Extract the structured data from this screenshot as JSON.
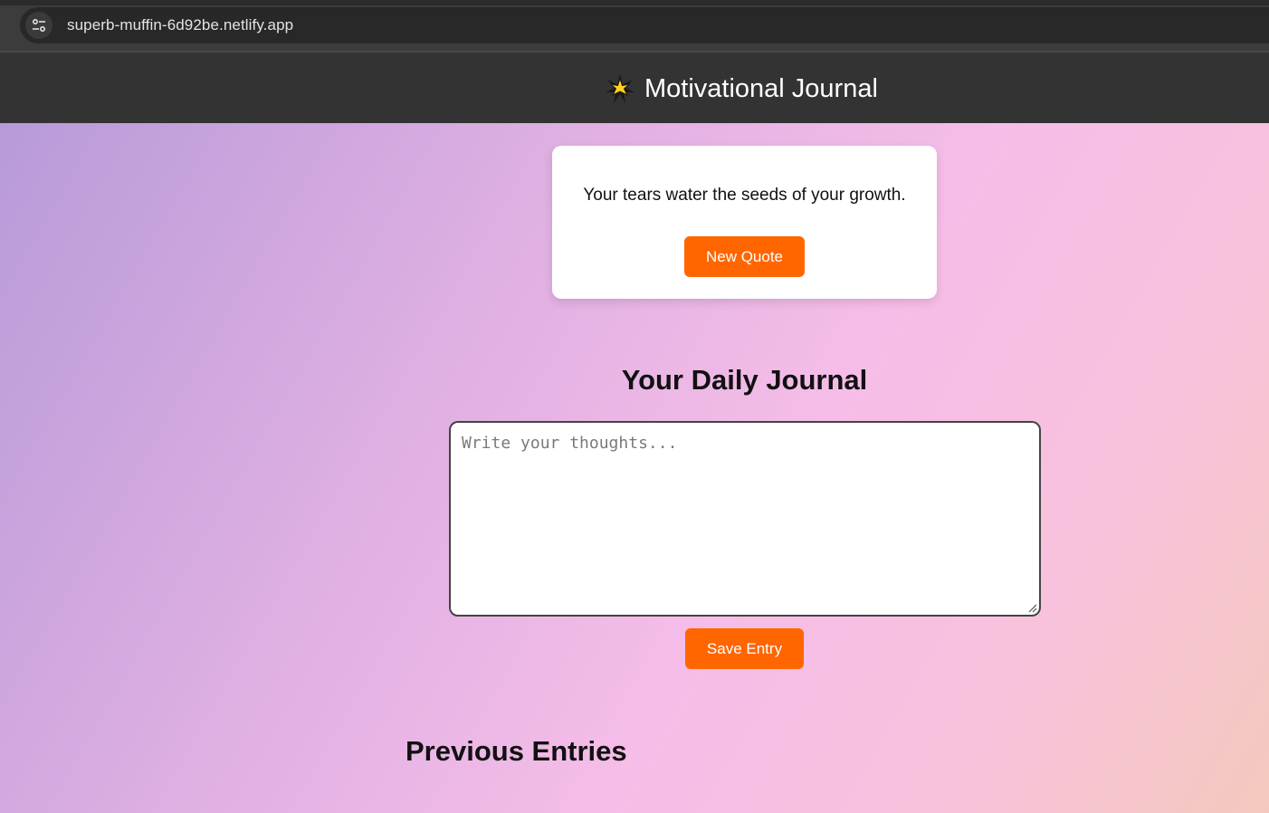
{
  "browser": {
    "url": "superb-muffin-6d92be.netlify.app",
    "site_info_icon": "tune-icon"
  },
  "header": {
    "icon": "star-icon",
    "title": "Motivational Journal"
  },
  "quote": {
    "text": "Your tears water the seeds of your growth.",
    "button_label": "New Quote"
  },
  "journal": {
    "heading": "Your Daily Journal",
    "placeholder": "Write your thoughts...",
    "value": "",
    "save_label": "Save Entry"
  },
  "entries": {
    "heading": "Previous Entries"
  },
  "colors": {
    "accent": "#ff6600",
    "header_bg": "#333333",
    "gradient_start": "#b89ad9",
    "gradient_mid": "#f6bde8",
    "gradient_end": "#f6c8bd"
  }
}
